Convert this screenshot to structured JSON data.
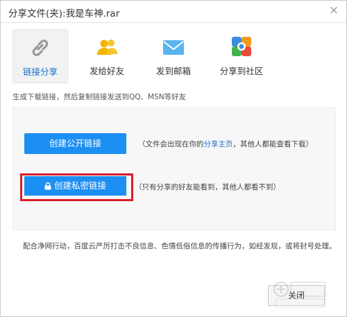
{
  "dialog": {
    "title": "分享文件(夹):我是车神.rar",
    "close_glyph": "×"
  },
  "tabs": [
    {
      "label": "链接分享",
      "icon": "link-icon",
      "active": true
    },
    {
      "label": "发给好友",
      "icon": "friends-icon",
      "active": false
    },
    {
      "label": "发到邮箱",
      "icon": "mail-icon",
      "active": false
    },
    {
      "label": "分享到社区",
      "icon": "community-icon",
      "active": false
    }
  ],
  "hint": "生成下载链接，然后复制链接发送到QQ、MSN等好友",
  "public_link": {
    "button_label": "创建公开链接",
    "desc_before": "（文件会出现在你的",
    "desc_link": "分享主页",
    "desc_after": "，其他人都能查看下载）"
  },
  "private_link": {
    "button_label": "创建私密链接",
    "desc": "（只有分享的好友能看到，其他人都看不到）"
  },
  "notice": "配合净网行动，百度云严厉打击不良信息、色情低俗信息的传播行为，如经发现，或将封号处理。",
  "footer": {
    "close_label": "关闭"
  },
  "colors": {
    "accent": "#1c8ff2",
    "highlight_frame": "#dc1c2b",
    "link": "#1a73c9"
  }
}
